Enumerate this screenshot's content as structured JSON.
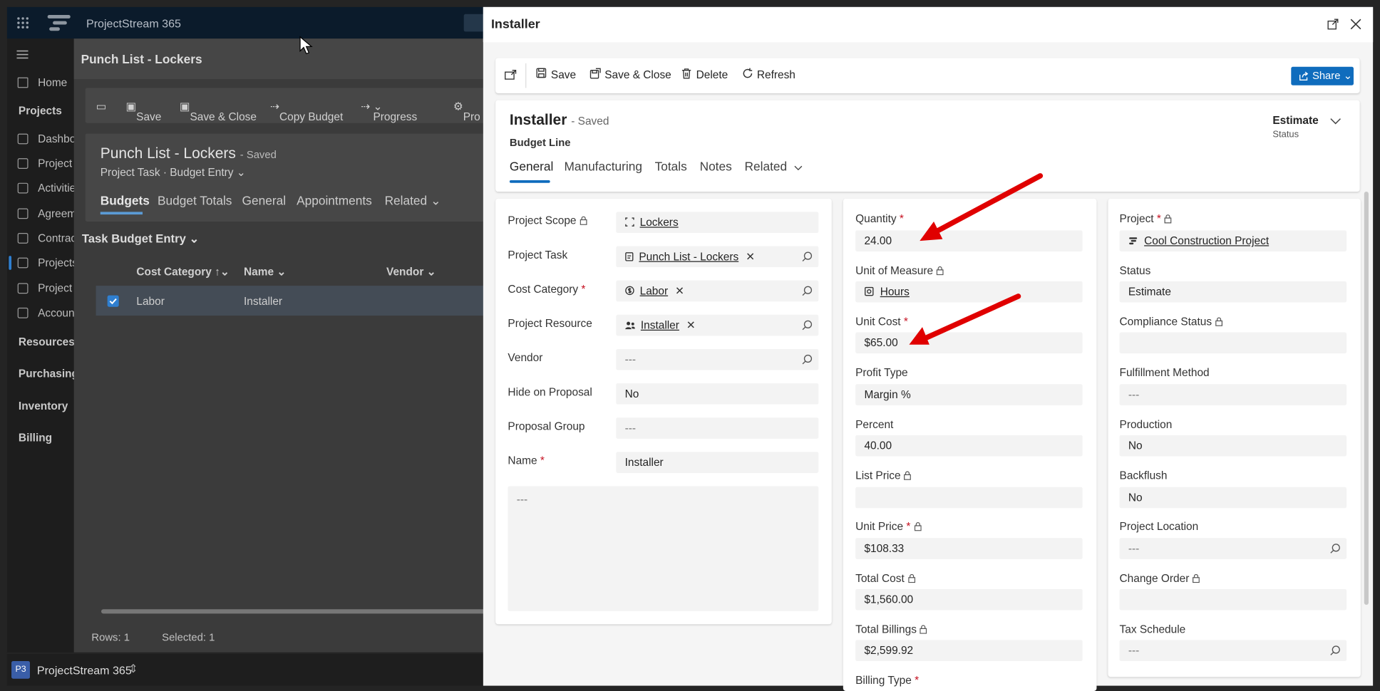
{
  "background_app": {
    "app_name": "ProjectStream 365",
    "nav": {
      "home": "Home",
      "projects_section": "Projects",
      "items": [
        "Dashbo",
        "Project I",
        "Activitie",
        "Agreem",
        "Contract",
        "Projects",
        "Project A",
        "Account"
      ],
      "sections": [
        "Resources",
        "Purchasing",
        "Inventory",
        "Billing"
      ]
    },
    "page_title": "Punch List - Lockers",
    "commands": [
      "Save",
      "Save & Close",
      "Copy Budget",
      "Progress",
      "Pro"
    ],
    "record": {
      "title": "Punch List - Lockers",
      "saved": "- Saved",
      "entity": "Project Task",
      "form": "Budget Entry"
    },
    "tabs": [
      "Budgets",
      "Budget Totals",
      "General",
      "Appointments",
      "Related"
    ],
    "subgrid_title": "Task Budget Entry",
    "grid": {
      "columns": [
        "Cost Category",
        "Name",
        "Vendor"
      ],
      "row": {
        "cost_category": "Labor",
        "name": "Installer"
      }
    },
    "status": {
      "rows": "Rows: 1",
      "selected": "Selected: 1"
    },
    "area_badge": "P3",
    "area_name": "ProjectStream 365"
  },
  "panel": {
    "window_title": "Installer",
    "commands": {
      "save": "Save",
      "save_close": "Save & Close",
      "delete": "Delete",
      "refresh": "Refresh",
      "share": "Share"
    },
    "record": {
      "title": "Installer",
      "saved": "- Saved",
      "entity": "Budget Line",
      "status_value": "Estimate",
      "status_label": "Status"
    },
    "tabs": [
      "General",
      "Manufacturing",
      "Totals",
      "Notes",
      "Related"
    ],
    "col1": {
      "project_scope": {
        "label": "Project Scope",
        "value": "Lockers"
      },
      "project_task": {
        "label": "Project Task",
        "value": "Punch List - Lockers"
      },
      "cost_category": {
        "label": "Cost Category",
        "value": "Labor"
      },
      "project_resource": {
        "label": "Project Resource",
        "value": "Installer"
      },
      "vendor": {
        "label": "Vendor",
        "value": "---"
      },
      "hide_on_proposal": {
        "label": "Hide on Proposal",
        "value": "No"
      },
      "proposal_group": {
        "label": "Proposal Group",
        "value": "---"
      },
      "name": {
        "label": "Name",
        "value": "Installer"
      },
      "description": {
        "value": "---"
      }
    },
    "col2": {
      "quantity": {
        "label": "Quantity",
        "value": "24.00"
      },
      "unit_of_measure": {
        "label": "Unit of Measure",
        "value": "Hours"
      },
      "unit_cost": {
        "label": "Unit Cost",
        "value": "$65.00"
      },
      "profit_type": {
        "label": "Profit Type",
        "value": "Margin %"
      },
      "percent": {
        "label": "Percent",
        "value": "40.00"
      },
      "list_price": {
        "label": "List Price",
        "value": ""
      },
      "unit_price": {
        "label": "Unit Price",
        "value": "$108.33"
      },
      "total_cost": {
        "label": "Total Cost",
        "value": "$1,560.00"
      },
      "total_billings": {
        "label": "Total Billings",
        "value": "$2,599.92"
      },
      "billing_type": {
        "label": "Billing Type"
      }
    },
    "col3": {
      "project": {
        "label": "Project",
        "value": "Cool Construction Project"
      },
      "status": {
        "label": "Status",
        "value": "Estimate"
      },
      "compliance_status": {
        "label": "Compliance Status",
        "value": ""
      },
      "fulfillment_method": {
        "label": "Fulfillment Method",
        "value": "---"
      },
      "production": {
        "label": "Production",
        "value": "No"
      },
      "backflush": {
        "label": "Backflush",
        "value": "No"
      },
      "project_location": {
        "label": "Project Location",
        "value": "---"
      },
      "change_order": {
        "label": "Change Order",
        "value": ""
      },
      "tax_schedule": {
        "label": "Tax Schedule",
        "value": "---"
      }
    },
    "required_marker": "*"
  },
  "colors": {
    "accent": "#0f6cbd",
    "annotation_arrow": "#e00000",
    "dim_background": "#3b3b3b"
  }
}
